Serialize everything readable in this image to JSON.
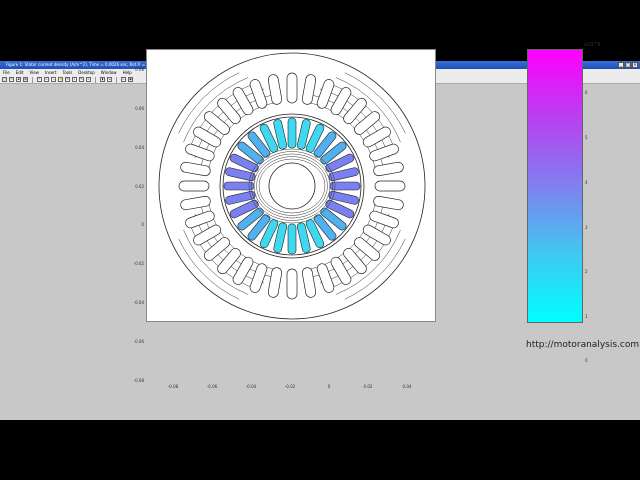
{
  "window": {
    "title": "Figure 1: Stator current density (A/m^2), Time = 0.0026 sec, Rot.P. = 1",
    "controls": [
      "_",
      "□",
      "×"
    ]
  },
  "menu": [
    "File",
    "Edit",
    "View",
    "Insert",
    "Tools",
    "Desktop",
    "Window",
    "Help"
  ],
  "toolbar": [
    "new-icon",
    "open-icon",
    "save-icon",
    "print-icon",
    "pointer-icon",
    "zoom-in-icon",
    "zoom-out-icon",
    "pan-icon",
    "rotate-icon",
    "data-cursor-icon",
    "brush-icon",
    "link-icon",
    "colorbar-icon",
    "legend-icon",
    "hide-plot-icon",
    "show-plot-icon"
  ],
  "plot": {
    "y_ticks": [
      "0.08",
      "0.06",
      "0.04",
      "0.02",
      "0",
      "-0.02",
      "-0.04",
      "-0.06",
      "-0.08"
    ],
    "x_ticks": [
      "-0.08",
      "-0.06",
      "-0.04",
      "-0.02",
      "0",
      "0.02",
      "0.04",
      "0.06",
      "0.08"
    ]
  },
  "colorbar": {
    "exponent": "x10^6",
    "ticks": [
      "6",
      "5",
      "4",
      "3",
      "2",
      "1",
      "0"
    ],
    "colors": {
      "top": "#ff00ff",
      "middle": "#8080ef",
      "bottom": "#00ffff"
    }
  },
  "watermark": "http://motoranalysis.com"
}
